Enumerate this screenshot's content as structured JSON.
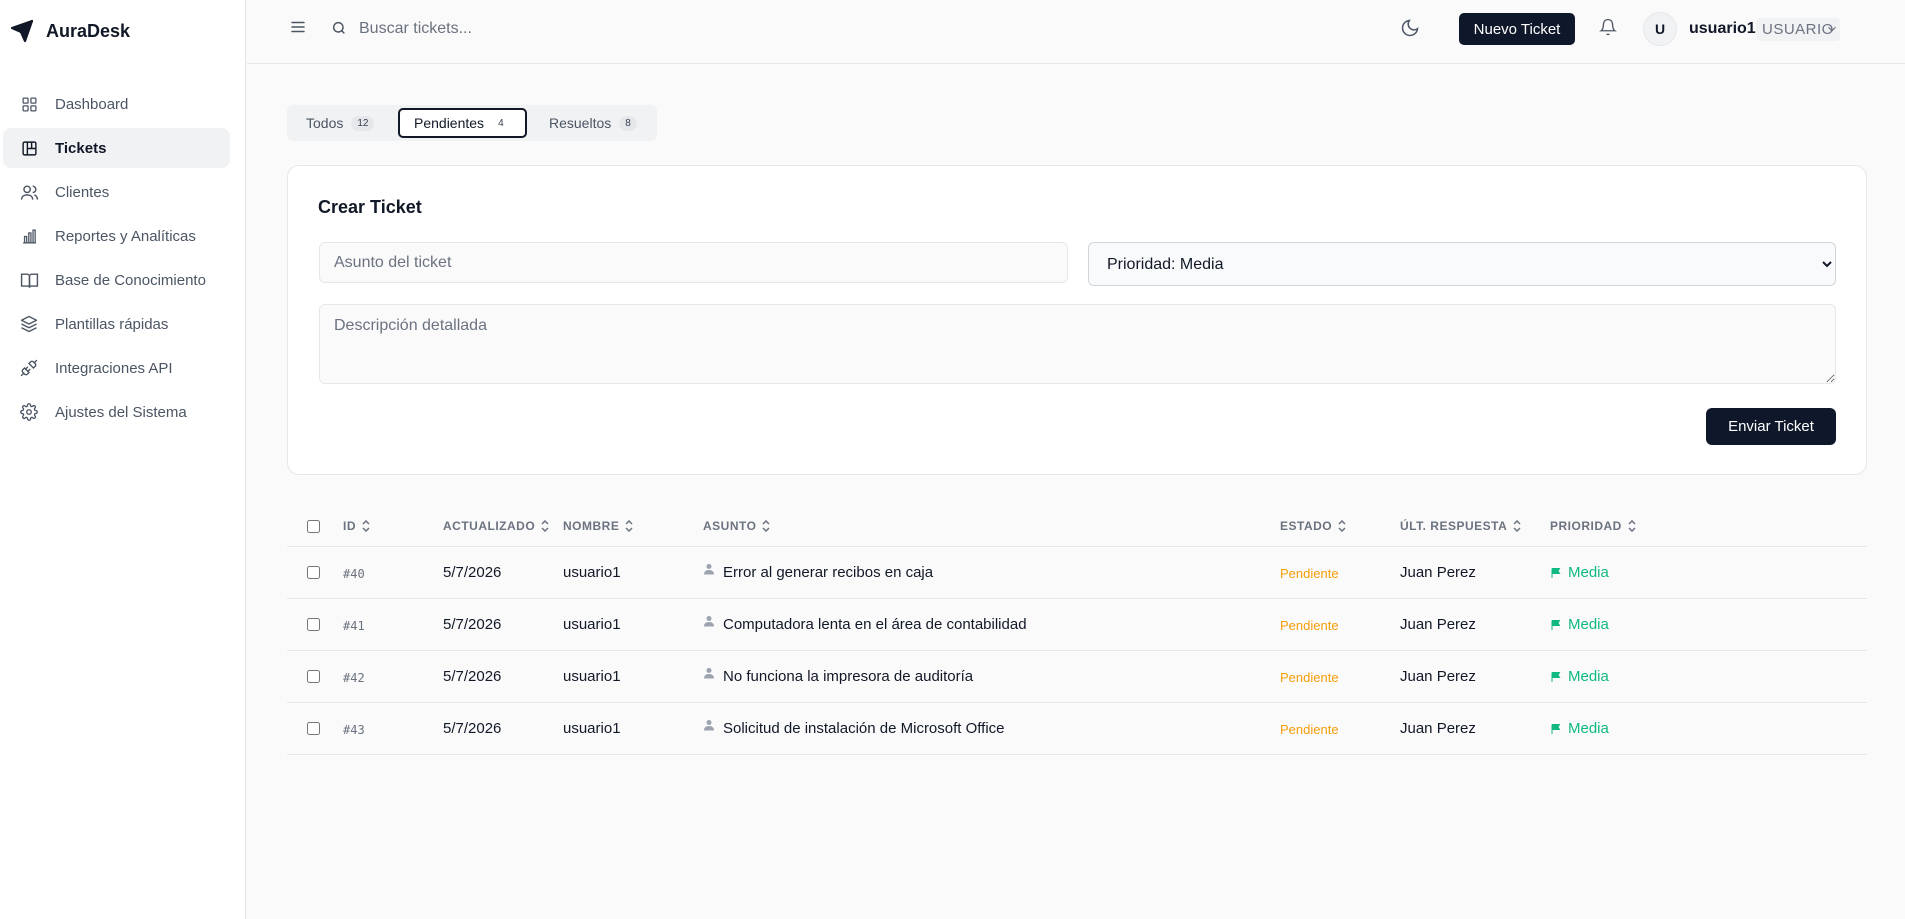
{
  "app": {
    "name": "AuraDesk"
  },
  "sidebar": {
    "items": [
      {
        "label": "Dashboard",
        "icon": "grid-icon"
      },
      {
        "label": "Tickets",
        "icon": "kanban-icon"
      },
      {
        "label": "Clientes",
        "icon": "users-icon"
      },
      {
        "label": "Reportes y Analíticas",
        "icon": "bar-chart-icon"
      },
      {
        "label": "Base de Conocimiento",
        "icon": "book-icon"
      },
      {
        "label": "Plantillas rápidas",
        "icon": "layers-icon"
      },
      {
        "label": "Integraciones API",
        "icon": "plug-icon"
      },
      {
        "label": "Ajustes del Sistema",
        "icon": "gear-icon"
      }
    ],
    "active": "Tickets"
  },
  "header": {
    "search_placeholder": "Buscar tickets...",
    "new_ticket_label": "Nuevo Ticket",
    "avatar_initial": "U",
    "username": "usuario1",
    "role": "USUARIO"
  },
  "tabs": [
    {
      "label": "Todos",
      "count": "12"
    },
    {
      "label": "Pendientes",
      "count": "4"
    },
    {
      "label": "Resueltos",
      "count": "8"
    }
  ],
  "create_ticket": {
    "title": "Crear Ticket",
    "subject_placeholder": "Asunto del ticket",
    "priority_selected": "Prioridad: Media",
    "description_placeholder": "Descripción detallada",
    "submit_label": "Enviar Ticket"
  },
  "table": {
    "columns": [
      "ID",
      "ACTUALIZADO",
      "NOMBRE",
      "ASUNTO",
      "ESTADO",
      "ÚLT. RESPUESTA",
      "PRIORIDAD"
    ],
    "rows": [
      {
        "id": "#40",
        "updated": "5/7/2026",
        "name": "usuario1",
        "subject": "Error al generar recibos en caja",
        "state": "Pendiente",
        "last_reply": "Juan Perez",
        "priority": "Media"
      },
      {
        "id": "#41",
        "updated": "5/7/2026",
        "name": "usuario1",
        "subject": "Computadora lenta en el área de contabilidad",
        "state": "Pendiente",
        "last_reply": "Juan Perez",
        "priority": "Media"
      },
      {
        "id": "#42",
        "updated": "5/7/2026",
        "name": "usuario1",
        "subject": "No funciona la impresora de auditoría",
        "state": "Pendiente",
        "last_reply": "Juan Perez",
        "priority": "Media"
      },
      {
        "id": "#43",
        "updated": "5/7/2026",
        "name": "usuario1",
        "subject": "Solicitud de instalación de Microsoft Office",
        "state": "Pendiente",
        "last_reply": "Juan Perez",
        "priority": "Media"
      }
    ]
  },
  "colors": {
    "primary": "#0f172a",
    "pending": "#f59e0b",
    "priority_medium": "#10b981"
  }
}
